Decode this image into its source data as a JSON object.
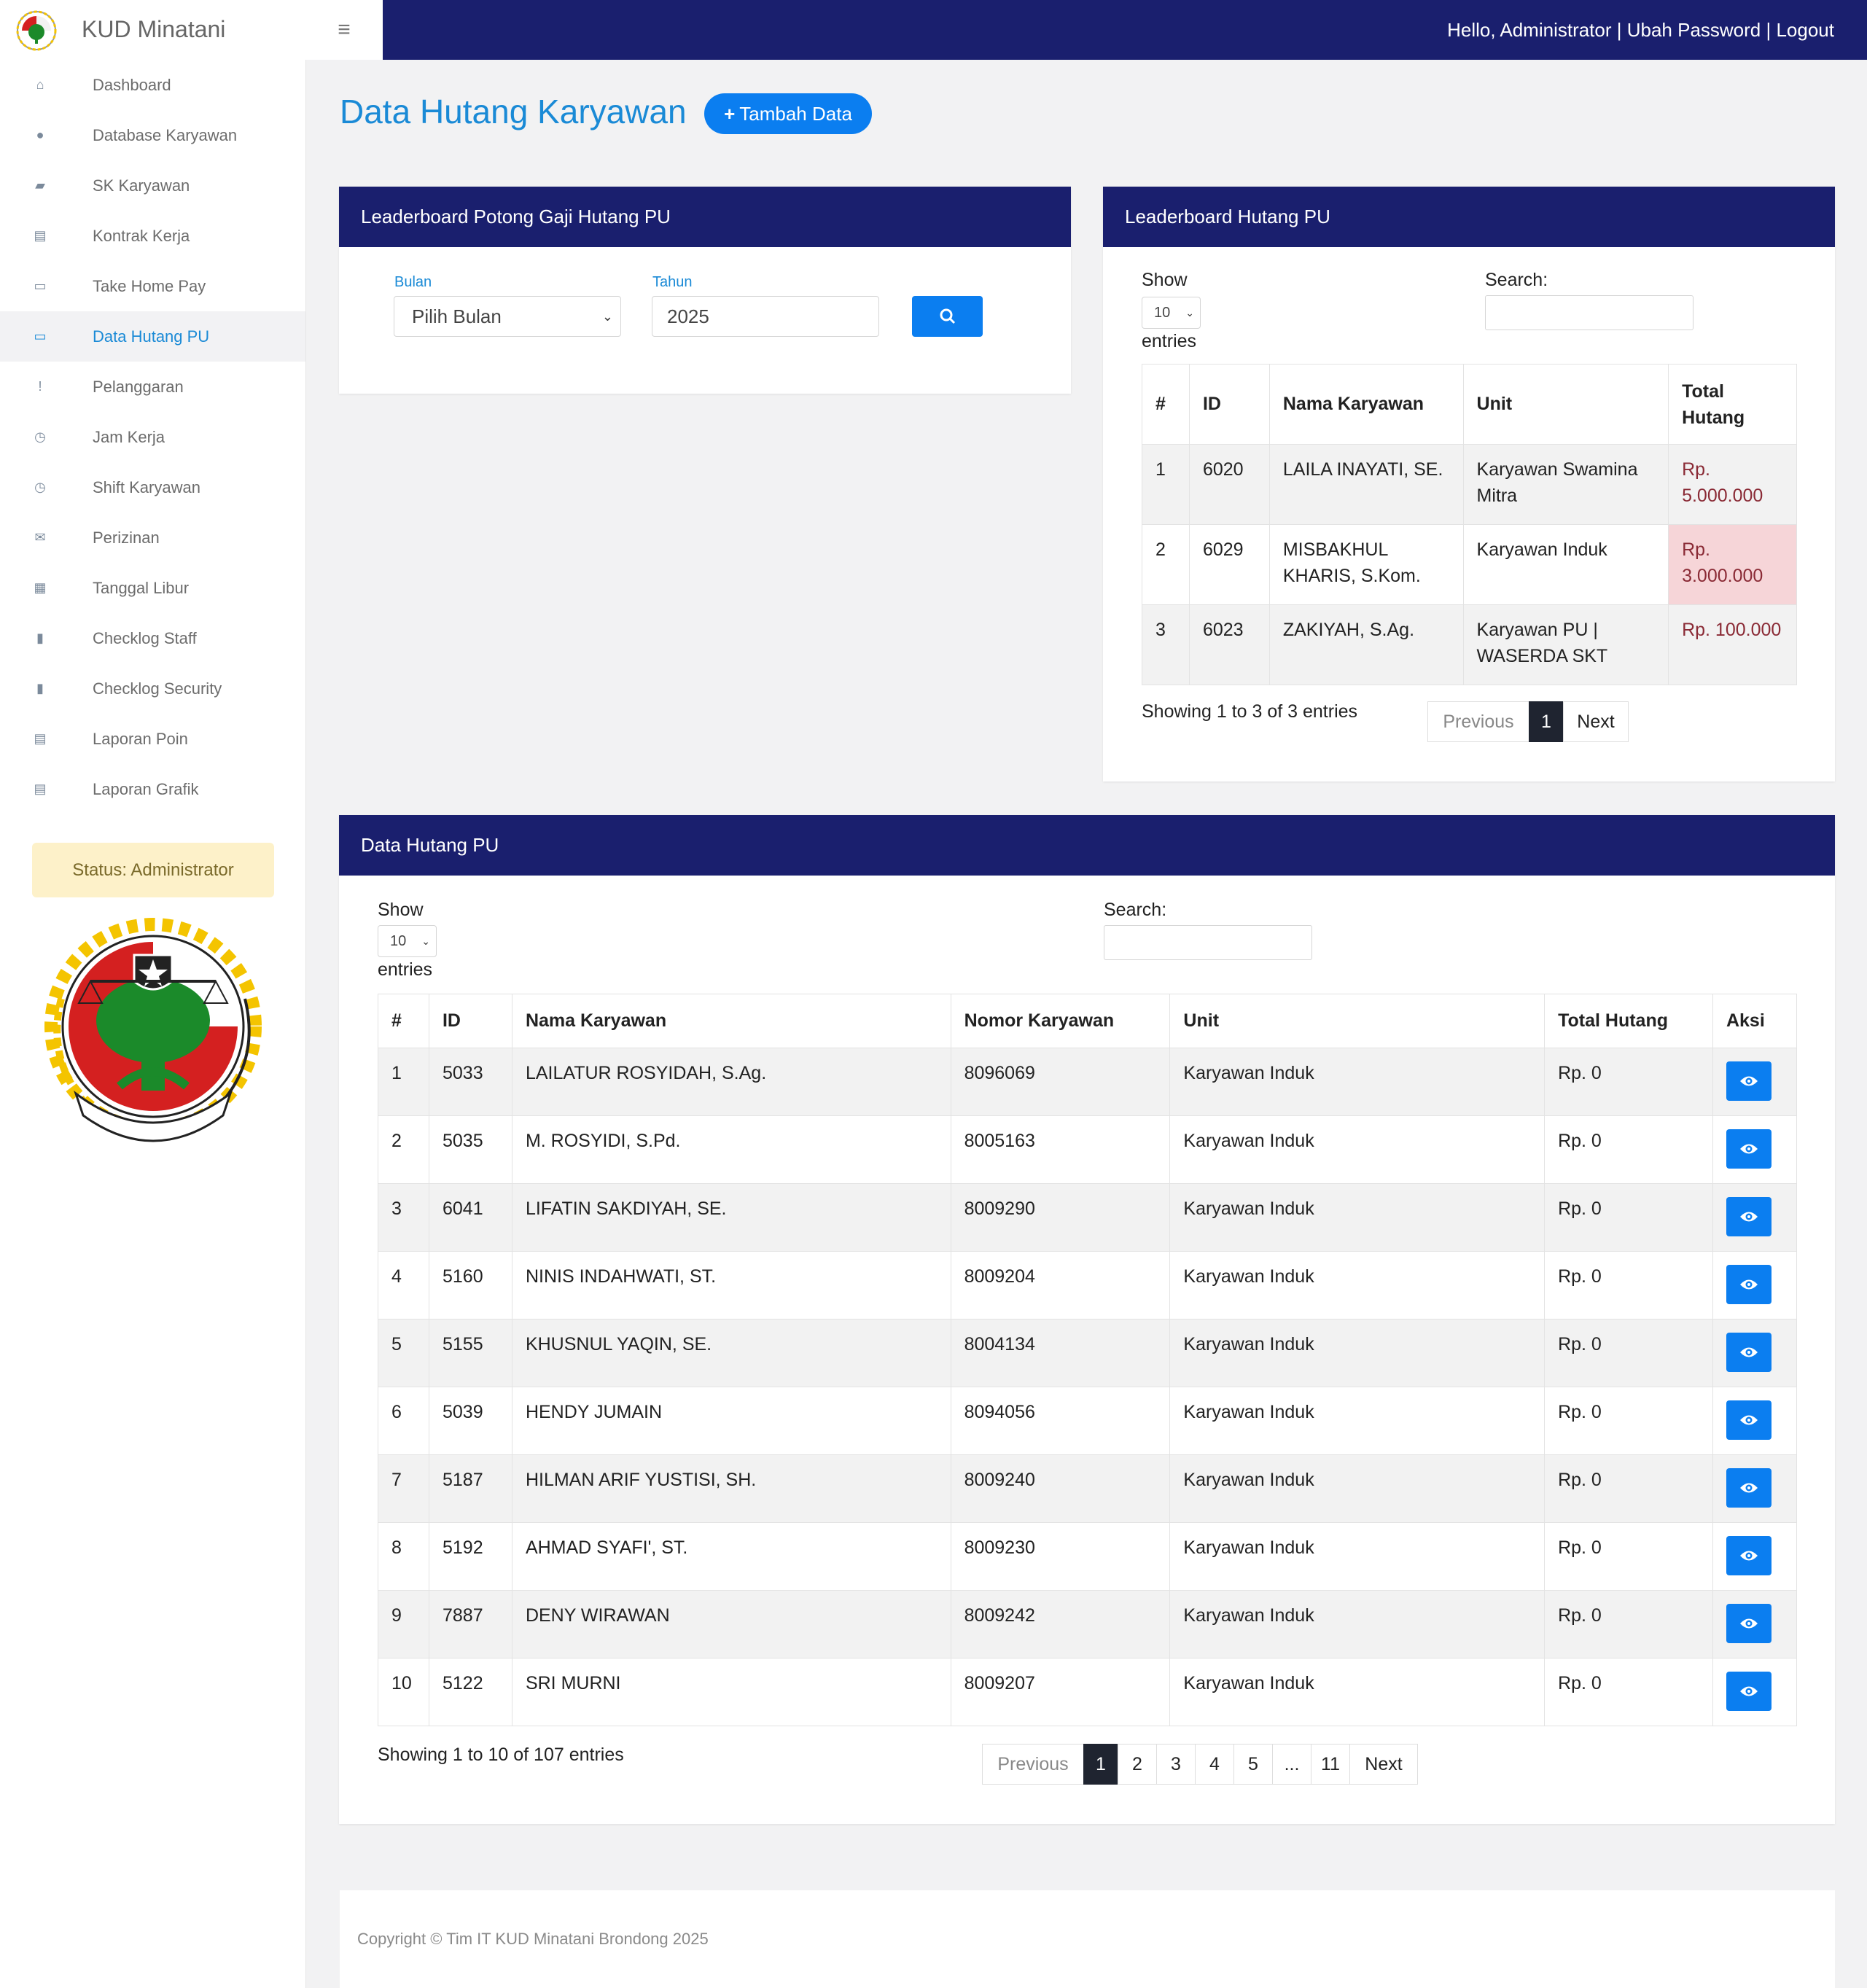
{
  "app": {
    "brand": "KUD Minatani",
    "greeting": "Hello, Administrator | Ubah Password | Logout"
  },
  "sidebar": {
    "items": [
      {
        "label": "Dashboard",
        "icon": "home-icon"
      },
      {
        "label": "Database Karyawan",
        "icon": "user-icon"
      },
      {
        "label": "SK Karyawan",
        "icon": "folder-icon"
      },
      {
        "label": "Kontrak Kerja",
        "icon": "file-icon"
      },
      {
        "label": "Take Home Pay",
        "icon": "money-icon"
      },
      {
        "label": "Data Hutang PU",
        "icon": "money-icon",
        "active": true
      },
      {
        "label": "Pelanggaran",
        "icon": "exclamation-icon"
      },
      {
        "label": "Jam Kerja",
        "icon": "clock-icon"
      },
      {
        "label": "Shift Karyawan",
        "icon": "clock-icon"
      },
      {
        "label": "Perizinan",
        "icon": "envelope-icon"
      },
      {
        "label": "Tanggal Libur",
        "icon": "calendar-icon"
      },
      {
        "label": "Checklog Staff",
        "icon": "book-icon"
      },
      {
        "label": "Checklog Security",
        "icon": "book-icon"
      },
      {
        "label": "Laporan Poin",
        "icon": "file-icon"
      },
      {
        "label": "Laporan Grafik",
        "icon": "file-icon"
      }
    ],
    "status": "Status: Administrator"
  },
  "page": {
    "title": "Data Hutang Karyawan",
    "add_button": "Tambah Data"
  },
  "filter_card": {
    "title": "Leaderboard Potong Gaji Hutang PU",
    "month_label": "Bulan",
    "month_value": "Pilih Bulan",
    "year_label": "Tahun",
    "year_value": "2025"
  },
  "leaderboard": {
    "title": "Leaderboard Hutang PU",
    "show": "Show",
    "length": "10",
    "entries": "entries",
    "search": "Search:",
    "headers": [
      "#",
      "ID",
      "Nama Karyawan",
      "Unit",
      "Total Hutang"
    ],
    "rows": [
      [
        "1",
        "6020",
        "LAILA INAYATI, SE.",
        "Karyawan Swamina Mitra",
        "Rp. 5.000.000"
      ],
      [
        "2",
        "6029",
        "MISBAKHUL KHARIS, S.Kom.",
        "Karyawan Induk",
        "Rp. 3.000.000"
      ],
      [
        "3",
        "6023",
        "ZAKIYAH, S.Ag.",
        "Karyawan PU | WASERDA SKT",
        "Rp. 100.000"
      ]
    ],
    "info": "Showing 1 to 3 of 3 entries",
    "pager": [
      "Previous",
      "1",
      "Next"
    ]
  },
  "data_card": {
    "title": "Data Hutang PU",
    "show": "Show",
    "length": "10",
    "entries": "entries",
    "search": "Search:",
    "headers": [
      "#",
      "ID",
      "Nama Karyawan",
      "Nomor Karyawan",
      "Unit",
      "Total Hutang",
      "Aksi"
    ],
    "rows": [
      [
        "1",
        "5033",
        "LAILATUR ROSYIDAH, S.Ag.",
        "8096069",
        "Karyawan Induk",
        "Rp. 0"
      ],
      [
        "2",
        "5035",
        "M. ROSYIDI, S.Pd.",
        "8005163",
        "Karyawan Induk",
        "Rp. 0"
      ],
      [
        "3",
        "6041",
        "LIFATIN SAKDIYAH, SE.",
        "8009290",
        "Karyawan Induk",
        "Rp. 0"
      ],
      [
        "4",
        "5160",
        "NINIS INDAHWATI, ST.",
        "8009204",
        "Karyawan Induk",
        "Rp. 0"
      ],
      [
        "5",
        "5155",
        "KHUSNUL YAQIN, SE.",
        "8004134",
        "Karyawan Induk",
        "Rp. 0"
      ],
      [
        "6",
        "5039",
        "HENDY JUMAIN",
        "8094056",
        "Karyawan Induk",
        "Rp. 0"
      ],
      [
        "7",
        "5187",
        "HILMAN ARIF YUSTISI, SH.",
        "8009240",
        "Karyawan Induk",
        "Rp. 0"
      ],
      [
        "8",
        "5192",
        "AHMAD SYAFI', ST.",
        "8009230",
        "Karyawan Induk",
        "Rp. 0"
      ],
      [
        "9",
        "7887",
        "DENY WIRAWAN",
        "8009242",
        "Karyawan Induk",
        "Rp. 0"
      ],
      [
        "10",
        "5122",
        "SRI MURNI",
        "8009207",
        "Karyawan Induk",
        "Rp. 0"
      ]
    ],
    "info": "Showing 1 to 10 of 107 entries",
    "pager": [
      "Previous",
      "1",
      "2",
      "3",
      "4",
      "5",
      "...",
      "11",
      "Next"
    ]
  },
  "footer": {
    "text": "Copyright © Tim IT KUD Minatani Brondong 2025"
  },
  "colors": {
    "navy": "#1a1f6e",
    "accent": "#0b7ef0",
    "debt_bg": "#f6d5d8"
  }
}
